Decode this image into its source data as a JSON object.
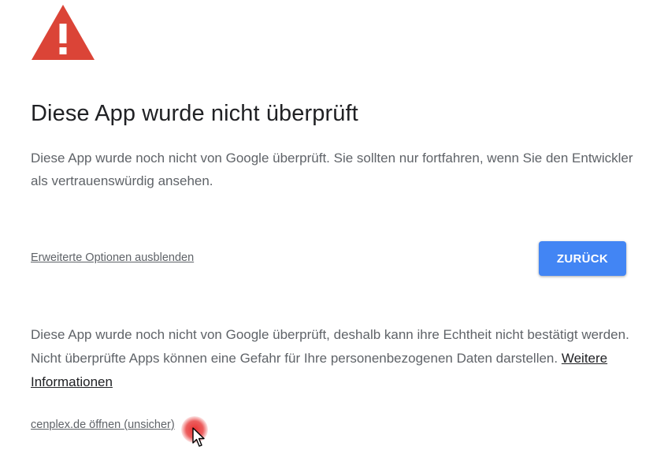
{
  "icons": {
    "warning": "warning-triangle-icon",
    "cursor": "mouse-pointer-icon"
  },
  "colors": {
    "warning_red": "#db4437",
    "button_blue": "#4285f4",
    "text_gray": "#5f6368",
    "title_dark": "#202124"
  },
  "warning": {
    "title": "Diese App wurde nicht überprüft",
    "intro": "Diese App wurde noch nicht von Google überprüft. Sie sollten nur fortfahren, wenn Sie den Entwickler als vertrauenswürdig ansehen."
  },
  "actions": {
    "toggle_advanced_label": "Erweiterte Optionen ausblenden",
    "back_label": "ZURÜCK"
  },
  "details": {
    "text": "Diese App wurde noch nicht von Google überprüft, deshalb kann ihre Echtheit nicht bestätigt werden. Nicht überprüfte Apps können eine Gefahr für Ihre personenbezogenen Daten darstellen.",
    "more_info_label": "Weitere Informationen",
    "unsafe_link_label": "cenplex.de öffnen (unsicher)"
  }
}
